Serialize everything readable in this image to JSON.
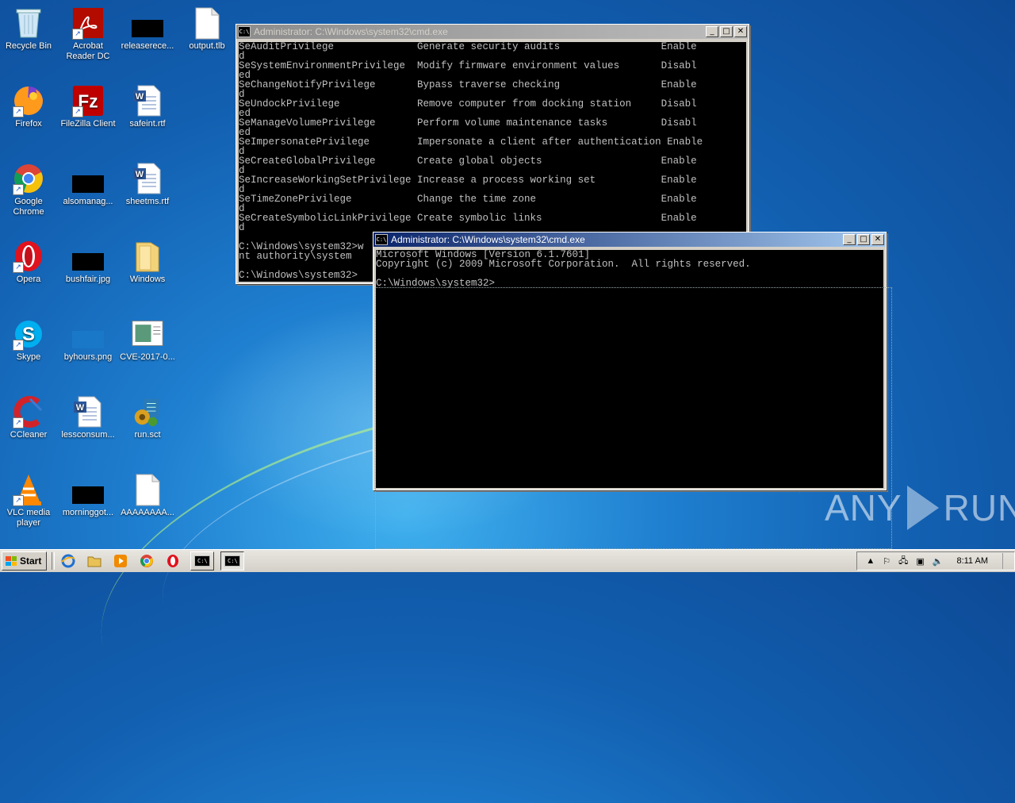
{
  "desktop": {
    "icons": [
      {
        "label": "Recycle Bin",
        "icon": "recycle-bin-icon"
      },
      {
        "label": "Acrobat Reader DC",
        "icon": "acrobat-icon"
      },
      {
        "label": "releaserece...",
        "icon": "black-thumbnail-icon"
      },
      {
        "label": "output.tlb",
        "icon": "blank-file-icon"
      },
      {
        "label": "Firefox",
        "icon": "firefox-icon"
      },
      {
        "label": "FileZilla Client",
        "icon": "filezilla-icon"
      },
      {
        "label": "safeint.rtf",
        "icon": "word-doc-icon"
      },
      {
        "label": "Google Chrome",
        "icon": "chrome-icon"
      },
      {
        "label": "alsomanag...",
        "icon": "black-thumbnail-icon"
      },
      {
        "label": "sheetms.rtf",
        "icon": "word-doc-icon"
      },
      {
        "label": "Opera",
        "icon": "opera-icon"
      },
      {
        "label": "bushfair.jpg",
        "icon": "black-thumbnail-icon"
      },
      {
        "label": "Windows",
        "icon": "folder-icon"
      },
      {
        "label": "Skype",
        "icon": "skype-icon"
      },
      {
        "label": "byhours.png",
        "icon": "blue-thumbnail-icon"
      },
      {
        "label": "CVE-2017-0...",
        "icon": "image-file-icon"
      },
      {
        "label": "CCleaner",
        "icon": "ccleaner-icon"
      },
      {
        "label": "lessconsum...",
        "icon": "word-doc-icon"
      },
      {
        "label": "run.sct",
        "icon": "script-icon"
      },
      {
        "label": "VLC media player",
        "icon": "vlc-icon"
      },
      {
        "label": "morninggot...",
        "icon": "black-thumbnail-icon"
      },
      {
        "label": "AAAAAAAA...",
        "icon": "blank-file-icon"
      }
    ]
  },
  "cmd_back": {
    "title": "Administrator: C:\\Windows\\system32\\cmd.exe",
    "text": "SeAuditPrivilege              Generate security audits                 Enable\nd\nSeSystemEnvironmentPrivilege  Modify firmware environment values       Disabl\ned\nSeChangeNotifyPrivilege       Bypass traverse checking                 Enable\nd\nSeUndockPrivilege             Remove computer from docking station     Disabl\ned\nSeManageVolumePrivilege       Perform volume maintenance tasks         Disabl\ned\nSeImpersonatePrivilege        Impersonate a client after authentication Enable\nd\nSeCreateGlobalPrivilege       Create global objects                    Enable\nd\nSeIncreaseWorkingSetPrivilege Increase a process working set           Enable\nd\nSeTimeZonePrivilege           Change the time zone                     Enable\nd\nSeCreateSymbolicLinkPrivilege Create symbolic links                    Enable\nd\n\nC:\\Windows\\system32>w\nnt authority\\system\n\nC:\\Windows\\system32>"
  },
  "cmd_front": {
    "title": "Administrator: C:\\Windows\\system32\\cmd.exe",
    "text": "Microsoft Windows [Version 6.1.7601]\nCopyright (c) 2009 Microsoft Corporation.  All rights reserved.\n\nC:\\Windows\\system32>"
  },
  "window_buttons": {
    "minimize": "_",
    "maximize": "□",
    "close": "✕"
  },
  "taskbar": {
    "start_label": "Start",
    "cmd_icon_text": "C:\\",
    "clock": "8:11 AM"
  },
  "watermark": {
    "left": "ANY",
    "right": "RUN"
  },
  "colors": {
    "cmd_bg": "#000000",
    "cmd_text": "#c0c0c0",
    "title_active": "#0a246a",
    "taskbar": "#d4d0c8"
  }
}
